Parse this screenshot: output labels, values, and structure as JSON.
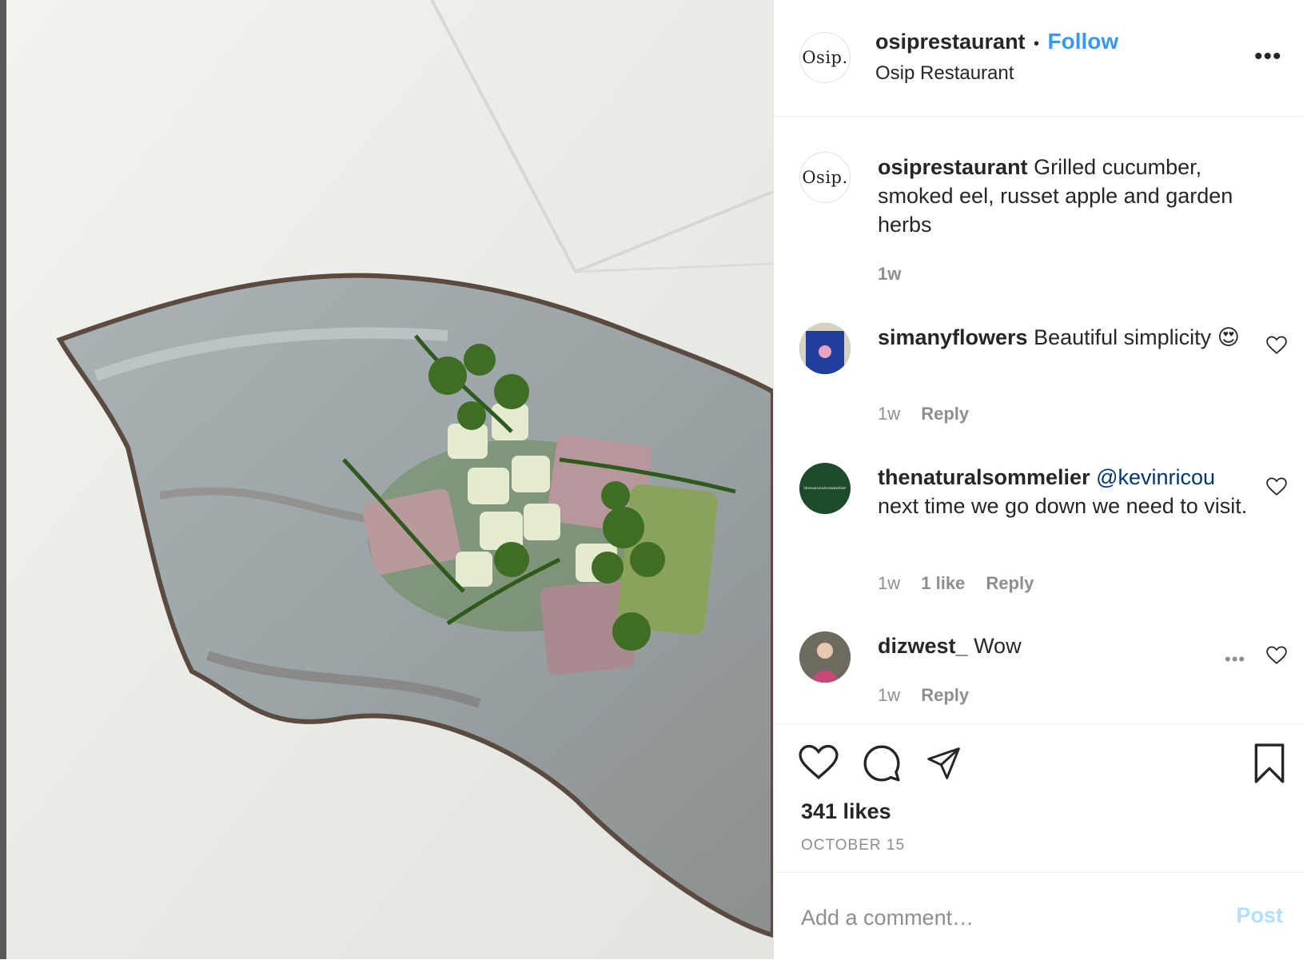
{
  "post": {
    "username": "osiprestaurant",
    "follow_label": "Follow",
    "separator": "•",
    "location": "Osip Restaurant",
    "avatar_text": "Osip.",
    "more_label": "•••",
    "caption": "Grilled cucumber, smoked eel, russet apple and garden herbs",
    "caption_time": "1w"
  },
  "comments": [
    {
      "username": "simanyflowers",
      "text": "Beautiful simplicity",
      "emoji": "😍",
      "time": "1w",
      "reply": "Reply"
    },
    {
      "username": "thenaturalsommelier",
      "mention": "@kevinricou",
      "text": "next time we go down we need to visit.",
      "avatar_text": "thenaturalsommelier",
      "time": "1w",
      "likes": "1 like",
      "reply": "Reply"
    },
    {
      "username": "dizwest_",
      "text": "Wow",
      "time": "1w",
      "reply": "Reply",
      "more_label": "•••"
    }
  ],
  "footer": {
    "likes": "341 likes",
    "date": "OCTOBER 15",
    "add_comment_placeholder": "Add a comment…",
    "post_label": "Post"
  },
  "colors": {
    "accent": "#3897f0",
    "post_disabled": "#b2dffc",
    "muted": "#8e8e8e",
    "sommelier_green": "#1e4a2c"
  },
  "icons": [
    "heart-icon",
    "comment-icon",
    "share-icon",
    "bookmark-icon",
    "more-icon"
  ]
}
